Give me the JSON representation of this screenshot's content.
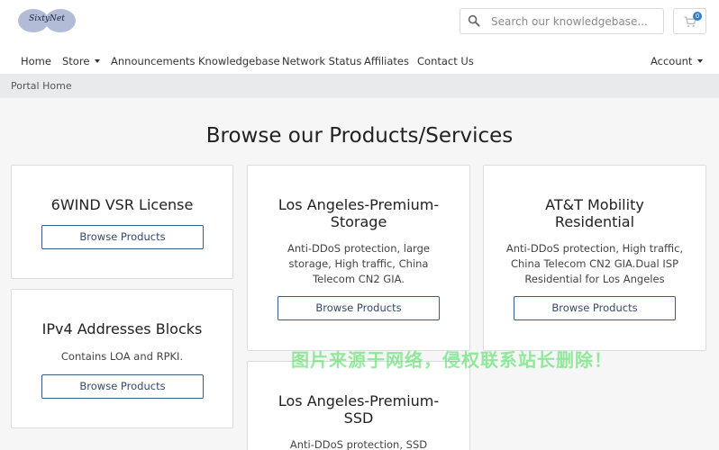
{
  "header": {
    "logo_text": "SixtyNet",
    "search": {
      "placeholder": "Search our knowledgebase..."
    },
    "cart": {
      "count": "0"
    }
  },
  "nav": {
    "items": [
      {
        "label": "Home"
      },
      {
        "label": "Store"
      },
      {
        "label": "Announcements"
      },
      {
        "label": "Knowledgebase"
      },
      {
        "label": "Network Status"
      },
      {
        "label": "Affiliates"
      },
      {
        "label": "Contact Us"
      }
    ],
    "account": "Account"
  },
  "breadcrumb": {
    "current": "Portal Home"
  },
  "main": {
    "title": "Browse our Products/Services",
    "button_label": "Browse Products",
    "cards": [
      {
        "title": "6WIND VSR License",
        "desc": ""
      },
      {
        "title": "IPv4 Addresses Blocks",
        "desc": "Contains LOA and RPKI."
      },
      {
        "title": "Los Angeles-Premium-Storage",
        "desc": "Anti-DDoS protection, large storage, High traffic, China Telecom CN2 GIA."
      },
      {
        "title": "Los Angeles-Premium-SSD",
        "desc": "Anti-DDoS protection, SSD"
      },
      {
        "title": "AT&T Mobility Residential",
        "desc": "Anti-DDoS protection, High traffic, China Telecom CN2 GIA.Dual ISP Residential for Los Angeles"
      }
    ]
  },
  "watermark": "图片来源于网络，侵权联系站长删除！",
  "colors": {
    "accent": "#3b5b89",
    "badge": "#2f80c8",
    "breadcrumb_bg": "#e9eaec",
    "page_bg": "#f6f6f6"
  }
}
